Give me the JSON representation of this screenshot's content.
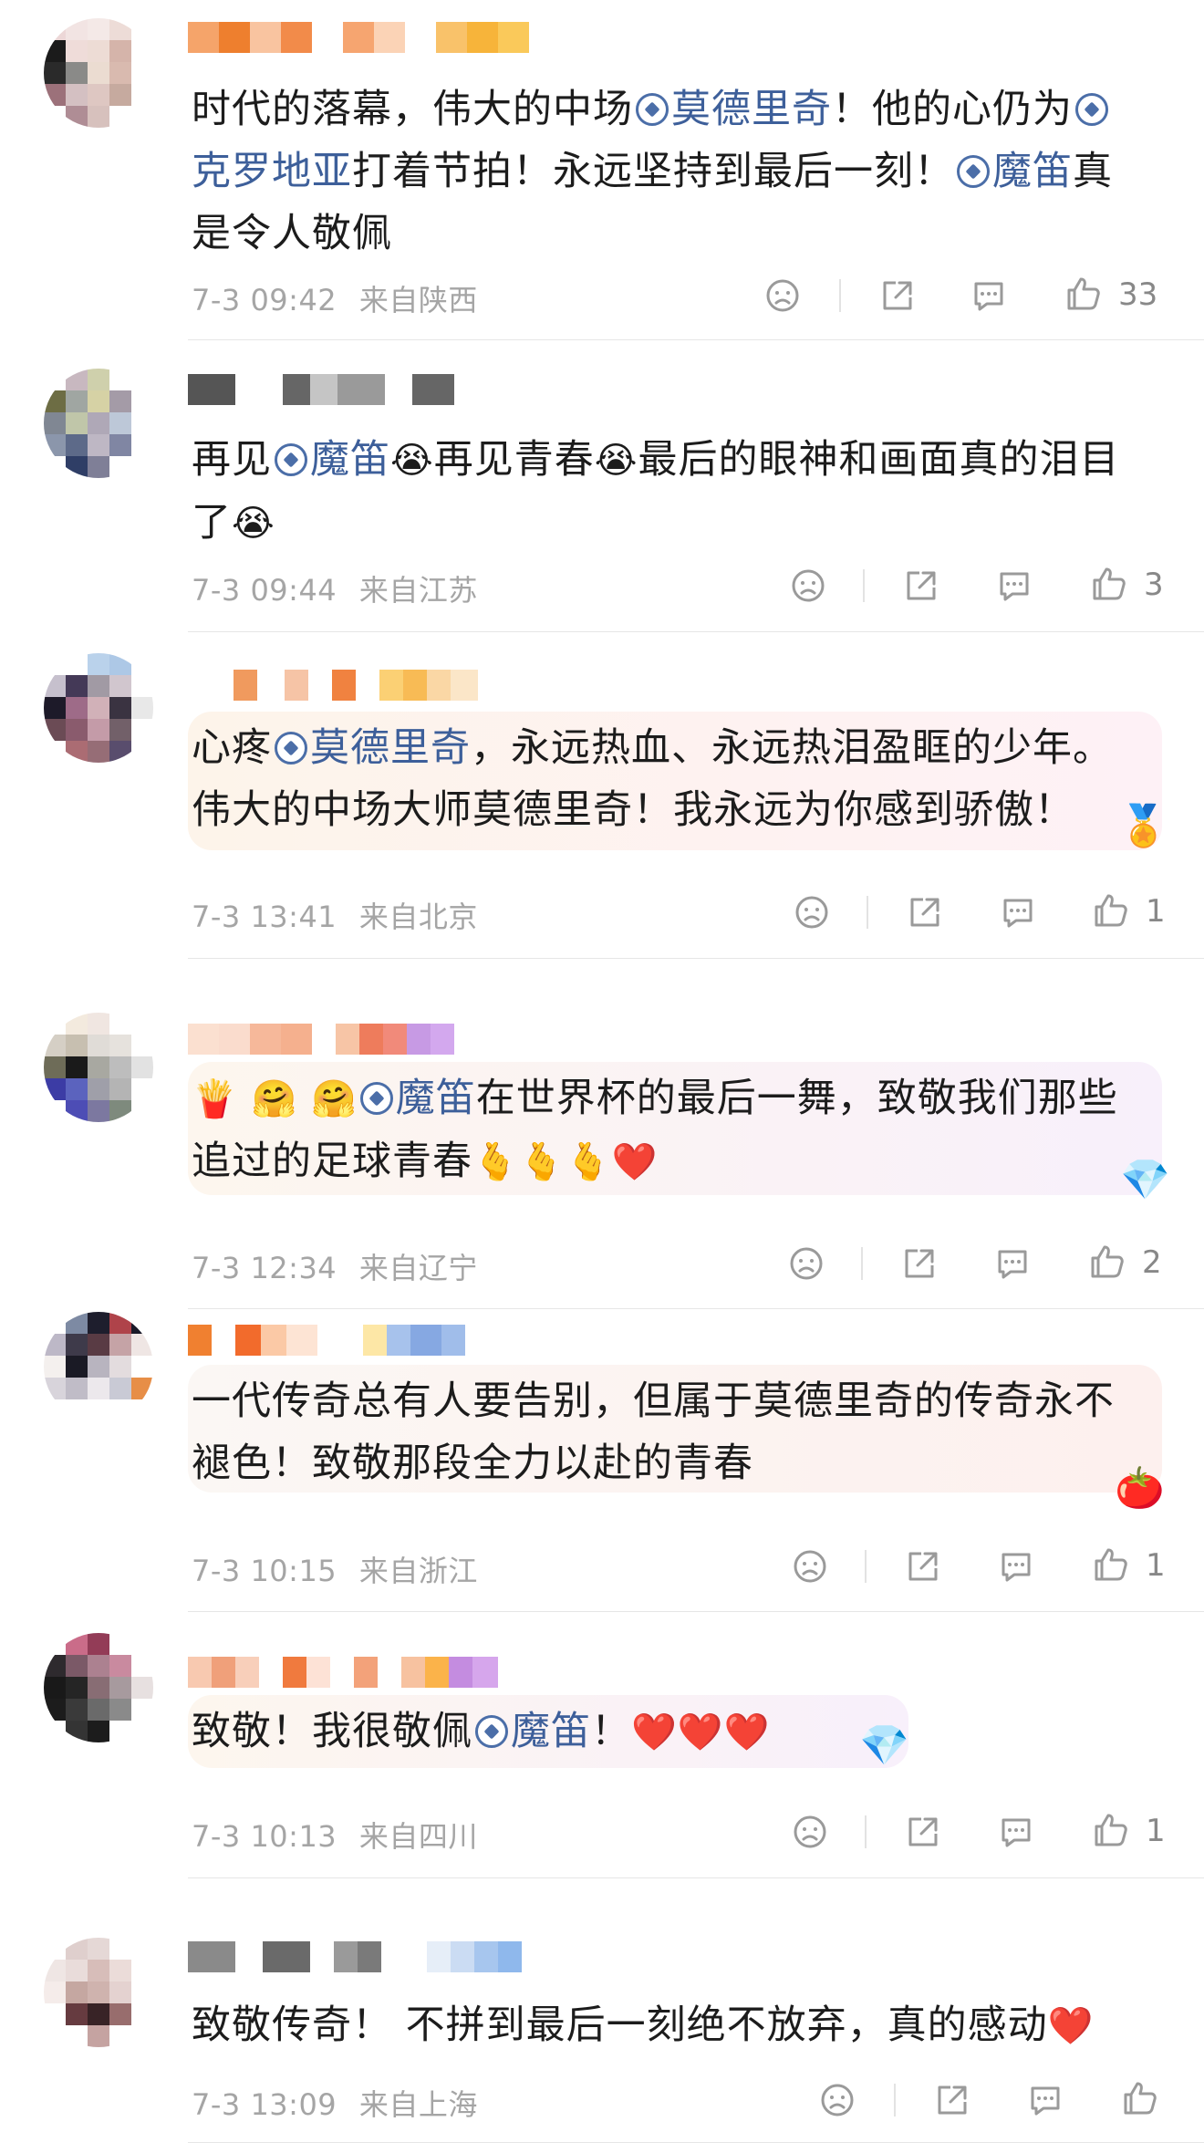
{
  "comments": [
    {
      "time": "7-3 09:42",
      "location": "来自陕西",
      "likes": "33",
      "segments": [
        {
          "t": "时代的落幕，伟大的中场"
        },
        {
          "ball": true
        },
        {
          "t": "莫德里奇",
          "link": true
        },
        {
          "t": "！他的心仍为"
        },
        {
          "ball": true
        },
        {
          "t": "克罗地亚",
          "link": true
        },
        {
          "t": "打着节拍！永远坚持到最后一刻！"
        },
        {
          "ball": true
        },
        {
          "t": "魔笛",
          "link": true
        },
        {
          "t": "真是令人敬佩"
        }
      ]
    },
    {
      "time": "7-3 09:44",
      "location": "来自江苏",
      "likes": "3",
      "segments": [
        {
          "t": "再见"
        },
        {
          "ball": true
        },
        {
          "t": "魔笛",
          "link": true
        },
        {
          "t": "😭",
          "emoji": true
        },
        {
          "t": "再见青春"
        },
        {
          "t": "😭",
          "emoji": true
        },
        {
          "t": "最后的眼神和画面真的泪目了"
        },
        {
          "t": "😭",
          "emoji": true
        }
      ]
    },
    {
      "time": "7-3 13:41",
      "location": "来自北京",
      "likes": "1",
      "segments": [
        {
          "t": "心疼"
        },
        {
          "ball": true
        },
        {
          "t": "莫德里奇",
          "link": true
        },
        {
          "t": "，永远热血、永远热泪盈眶的少年。伟大的中场大师莫德里奇！我永远为你感到骄傲！"
        }
      ]
    },
    {
      "time": "7-3 12:34",
      "location": "来自辽宁",
      "likes": "2",
      "segments": [
        {
          "t": "🍟",
          "emoji": true
        },
        {
          "t": " "
        },
        {
          "t": "🤗",
          "emoji": true
        },
        {
          "t": " "
        },
        {
          "t": "🤗",
          "emoji": true
        },
        {
          "ball": true
        },
        {
          "t": "魔笛",
          "link": true
        },
        {
          "t": "在世界杯的最后一舞，致敬我们那些追过的足球青春"
        },
        {
          "t": "🫰",
          "emoji": true
        },
        {
          "t": "🫰",
          "emoji": true
        },
        {
          "t": "🫰",
          "emoji": true
        },
        {
          "t": "❤️",
          "emoji": true
        }
      ]
    },
    {
      "time": "7-3 10:15",
      "location": "来自浙江",
      "likes": "1",
      "segments": [
        {
          "t": "一代传奇总有人要告别，但属于莫德里奇的传奇永不褪色！致敬那段全力以赴的青春"
        }
      ]
    },
    {
      "time": "7-3 10:13",
      "location": "来自四川",
      "likes": "1",
      "segments": [
        {
          "t": "致敬！我很敬佩"
        },
        {
          "ball": true
        },
        {
          "t": "魔笛",
          "link": true
        },
        {
          "t": "！"
        },
        {
          "t": "❤️",
          "emoji": true
        },
        {
          "t": "❤️",
          "emoji": true
        },
        {
          "t": "❤️",
          "emoji": true
        }
      ]
    },
    {
      "time": "7-3 13:09",
      "location": "来自上海",
      "likes": "",
      "segments": [
        {
          "t": "致敬传奇！ 不拼到最后一刻绝不放弃，真的感动"
        },
        {
          "t": "❤️",
          "emoji": true
        }
      ]
    }
  ],
  "colors": {
    "link": "#3d5f9a",
    "meta": "#a5a5a5",
    "divider": "#e6e6e6"
  },
  "icons": [
    "dislike-icon",
    "share-icon",
    "comment-icon",
    "like-icon"
  ]
}
